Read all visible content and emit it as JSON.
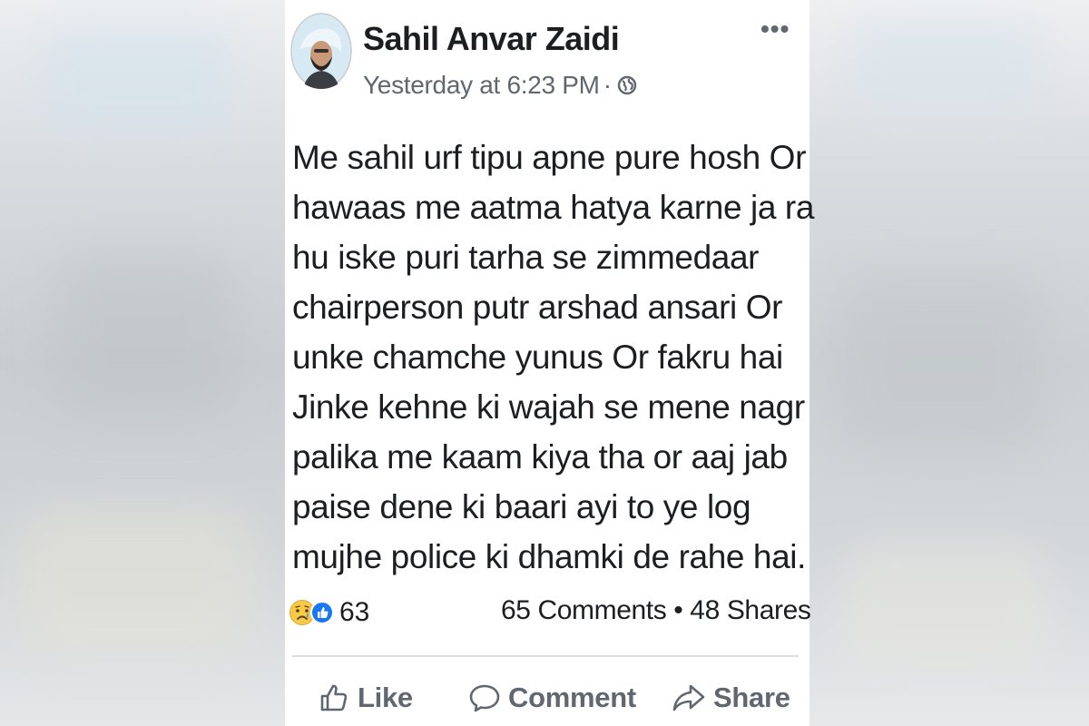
{
  "post": {
    "author": "Sahil Anvar Zaidi",
    "timestamp": "Yesterday at 6:23 PM",
    "separator": "·",
    "privacy_icon": "globe-icon",
    "more_label": "•••",
    "body_lines": [
      "Me sahil urf tipu apne pure hosh Or",
      "hawaas me aatma hatya karne ja ra",
      "hu iske puri tarha se zimmedaar",
      "chairperson putr arshad ansari Or",
      "unke chamche yunus Or fakru hai",
      "Jinke kehne ki wajah se mene nagr",
      "palika me kaam kiya tha or aaj jab",
      "paise dene ki baari ayi to ye log",
      "mujhe police ki dhamki de rahe hai."
    ],
    "reactions": {
      "icons": [
        "sad-reaction-icon",
        "like-reaction-icon"
      ],
      "count": "63"
    },
    "stats": "65 Comments • 48 Shares"
  },
  "actions": {
    "like_label": "Like",
    "comment_label": "Comment",
    "share_label": "Share"
  },
  "colors": {
    "text_primary": "#1c1e21",
    "text_secondary": "#606770",
    "like_blue": "#1877f2",
    "sad_yellow": "#f7c948",
    "divider": "#dadde1"
  }
}
